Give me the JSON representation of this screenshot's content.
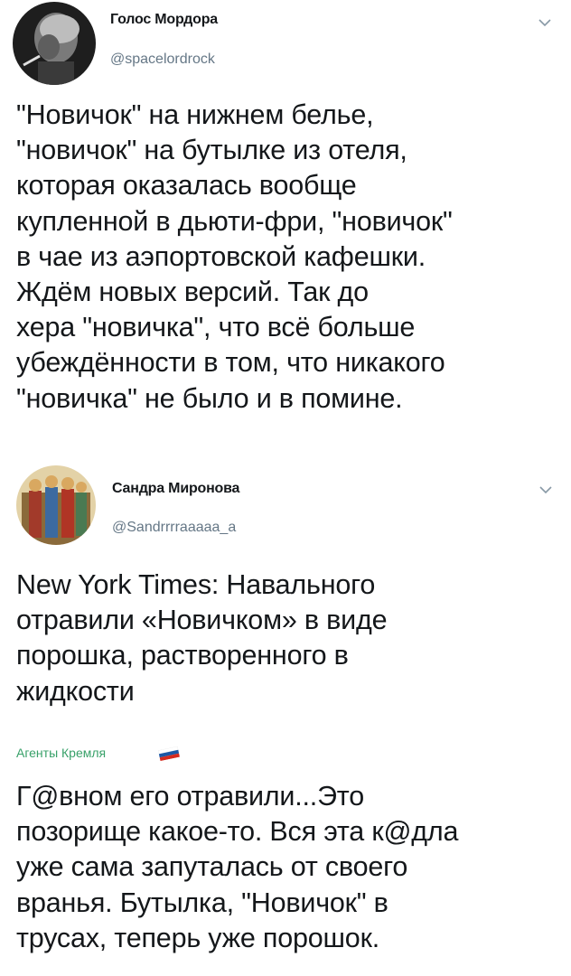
{
  "tweet1": {
    "author_name": "Голос Мордора",
    "author_handle": "@spacelordrock",
    "text": "\"Новичок\" на нижнем белье,\n\"новичок\" на бутылке из отеля,\nкоторая оказалась вообще\nкупленной в дьюти-фри, \"новичок\"\nв чае из аэпортовской кафешки.\nЖдём новых версий. Так до\nхера \"новичка\", что всё больше\nубеждённости в том, что никакого\n\"новичка\" не было и в помине."
  },
  "tweet2": {
    "author_name": "Сандра Миронова",
    "author_handle": "@Sandrrrraaaaa_a",
    "text": "New York Times: Навального\nотравили «Новичком» в виде\nпорошка, растворенного в\nжидкости"
  },
  "reply": {
    "label": "Агенты Кремля",
    "text": "Г@вном его отравили...Это\nпозорище какое-то. Вся эта к@дла\nуже сама запуталась от своего\nвранья. Бутылка, \"Новичок\" в\nтрусах, теперь уже порошок."
  },
  "colors": {
    "text": "#14171a",
    "secondary": "#657786",
    "label_green": "#38a169"
  },
  "icons": [
    "avatar-photo-icon",
    "chevron-down-icon",
    "russian-flag-icon"
  ]
}
